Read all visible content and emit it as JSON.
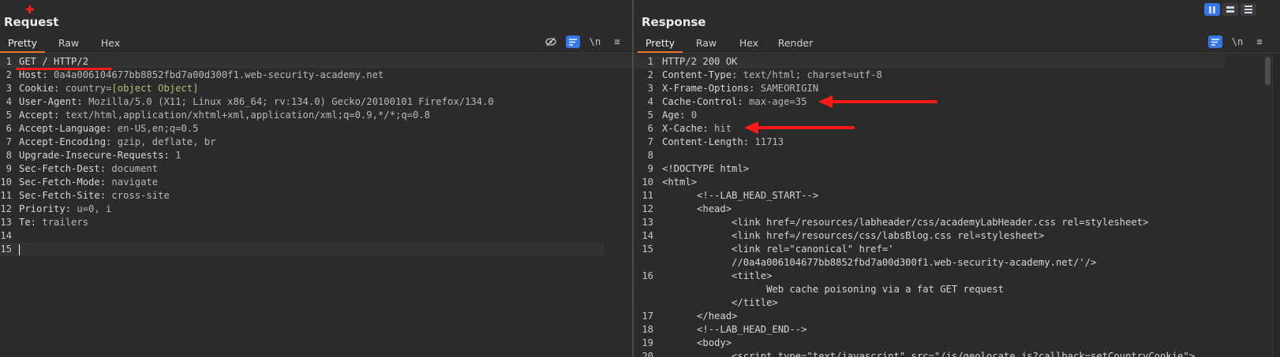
{
  "request": {
    "title": "Request",
    "tabs": [
      "Pretty",
      "Raw",
      "Hex"
    ],
    "active_tab": "Pretty",
    "tools": {
      "newline": "\\n",
      "menu": "≡"
    },
    "lines": [
      {
        "n": "1",
        "k": "GET / HTTP/2",
        "v": ""
      },
      {
        "n": "2",
        "k": "Host: ",
        "v": "0a4a006104677bb8852fbd7a00d300f1.web-security-academy.net"
      },
      {
        "n": "3",
        "k": "Cookie: ",
        "v": "country=",
        "obj": "[object Object]"
      },
      {
        "n": "4",
        "k": "User-Agent: ",
        "v": "Mozilla/5.0 (X11; Linux x86_64; rv:134.0) Gecko/20100101 Firefox/134.0"
      },
      {
        "n": "5",
        "k": "Accept: ",
        "v": "text/html,application/xhtml+xml,application/xml;q=0.9,*/*;q=0.8"
      },
      {
        "n": "6",
        "k": "Accept-Language: ",
        "v": "en-US,en;q=0.5"
      },
      {
        "n": "7",
        "k": "Accept-Encoding: ",
        "v": "gzip, deflate, br"
      },
      {
        "n": "8",
        "k": "Upgrade-Insecure-Requests: ",
        "v": "1"
      },
      {
        "n": "9",
        "k": "Sec-Fetch-Dest: ",
        "v": "document"
      },
      {
        "n": "10",
        "k": "Sec-Fetch-Mode: ",
        "v": "navigate"
      },
      {
        "n": "11",
        "k": "Sec-Fetch-Site: ",
        "v": "cross-site"
      },
      {
        "n": "12",
        "k": "Priority: ",
        "v": "u=0, i"
      },
      {
        "n": "13",
        "k": "Te: ",
        "v": "trailers"
      },
      {
        "n": "14",
        "k": "",
        "v": ""
      },
      {
        "n": "15",
        "k": "",
        "v": ""
      }
    ]
  },
  "response": {
    "title": "Response",
    "tabs": [
      "Pretty",
      "Raw",
      "Hex",
      "Render"
    ],
    "active_tab": "Pretty",
    "tools": {
      "newline": "\\n",
      "menu": "≡"
    },
    "lines": [
      {
        "n": "1",
        "text": "HTTP/2 200 OK"
      },
      {
        "n": "2",
        "k": "Content-Type: ",
        "v": "text/html; charset=utf-8"
      },
      {
        "n": "3",
        "k": "X-Frame-Options: ",
        "v": "SAMEORIGIN"
      },
      {
        "n": "4",
        "k": "Cache-Control: ",
        "v": "max-age=35"
      },
      {
        "n": "5",
        "k": "Age: ",
        "v": "0"
      },
      {
        "n": "6",
        "k": "X-Cache: ",
        "v": "hit"
      },
      {
        "n": "7",
        "k": "Content-Length: ",
        "v": "11713"
      },
      {
        "n": "8",
        "text": ""
      },
      {
        "n": "9",
        "text": "<!DOCTYPE html>"
      },
      {
        "n": "10",
        "text": "<html>"
      },
      {
        "n": "11",
        "text": "      <!--LAB_HEAD_START-->"
      },
      {
        "n": "12",
        "text": "      <head>"
      },
      {
        "n": "13",
        "text": "            <link href=/resources/labheader/css/academyLabHeader.css rel=stylesheet>"
      },
      {
        "n": "14",
        "text": "            <link href=/resources/css/labsBlog.css rel=stylesheet>"
      },
      {
        "n": "15",
        "text": "            <link rel=\"canonical\" href='"
      },
      {
        "n": "",
        "text": "            //0a4a006104677bb8852fbd7a00d300f1.web-security-academy.net/'/>"
      },
      {
        "n": "16",
        "text": "            <title>"
      },
      {
        "n": "",
        "text": "                  Web cache poisoning via a fat GET request"
      },
      {
        "n": "",
        "text": "            </title>"
      },
      {
        "n": "17",
        "text": "      </head>"
      },
      {
        "n": "18",
        "text": "      <!--LAB_HEAD_END-->"
      },
      {
        "n": "19",
        "text": "      <body>"
      },
      {
        "n": "20",
        "text": "            <script type=\"text/javascript\" src=\"/js/geolocate.js?callback=setCountryCookie\">"
      }
    ]
  },
  "colors": {
    "accent": "#e8732d",
    "highlight": "#3578e5",
    "annotation": "#ff1a1a"
  }
}
